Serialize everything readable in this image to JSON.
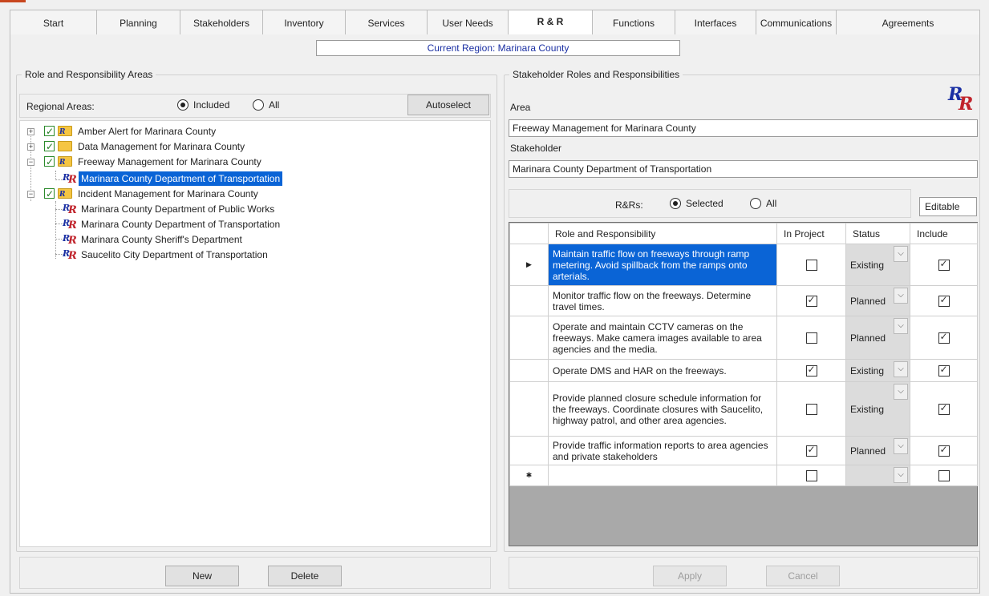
{
  "tabs": [
    {
      "label": "Start",
      "w": 0
    },
    {
      "label": "Planning"
    },
    {
      "label": "Stakeholders"
    },
    {
      "label": "Inventory"
    },
    {
      "label": "Services"
    },
    {
      "label": "User Needs"
    },
    {
      "label": "R & R",
      "active": true
    },
    {
      "label": "Functions"
    },
    {
      "label": "Interfaces"
    },
    {
      "label": "Communications"
    },
    {
      "label": "Agreements"
    }
  ],
  "region": "Current Region: Marinara County",
  "left": {
    "title": "Role and Responsibility Areas",
    "regional_label": "Regional Areas:",
    "radio_included": "Included",
    "radio_all": "All",
    "autoselect": "Autoselect",
    "tree": [
      {
        "label": "Amber Alert for Marinara County"
      },
      {
        "label": "Data Management for Marinara County"
      },
      {
        "label": "Freeway Management for Marinara County"
      },
      {
        "label": "Marinara County Department of Transportation"
      },
      {
        "label": "Incident Management for Marinara County"
      },
      {
        "label": "Marinara County Department of Public Works"
      },
      {
        "label": "Marinara County Department of Transportation"
      },
      {
        "label": "Marinara County Sheriff's Department"
      },
      {
        "label": "Saucelito City Department of Transportation"
      }
    ],
    "new_button": "New",
    "delete_button": "Delete"
  },
  "right": {
    "title": "Stakeholder Roles and Responsibilities",
    "area_label": "Area",
    "area_value": "Freeway Management for Marinara County",
    "stakeholder_label": "Stakeholder",
    "stakeholder_value": "Marinara County Department of Transportation",
    "rrs_label": "R&Rs:",
    "radio_selected": "Selected",
    "radio_all": "All",
    "editable": "Editable",
    "columns": [
      "Role and Responsibility",
      "In Project",
      "Status",
      "Include"
    ],
    "rows": [
      {
        "text": "Maintain traffic flow on freeways through ramp metering.  Avoid spillback from the ramps onto arterials.",
        "in_project": false,
        "status": "Existing",
        "include": true,
        "selected": true
      },
      {
        "text": "Monitor traffic flow on the freeways. Determine travel times.",
        "in_project": true,
        "status": "Planned",
        "include": true
      },
      {
        "text": "Operate and maintain CCTV cameras on the freeways.  Make camera images available to area agencies and the media.",
        "in_project": false,
        "status": "Planned",
        "include": true
      },
      {
        "text": "Operate DMS and HAR on the freeways.",
        "in_project": true,
        "status": "Existing",
        "include": true
      },
      {
        "text": "Provide planned closure schedule information for the freeways. Coordinate closures with Saucelito, highway patrol, and other area agencies.",
        "in_project": false,
        "status": "Existing",
        "include": true
      },
      {
        "text": "Provide traffic information reports to area agencies and private stakeholders",
        "in_project": true,
        "status": "Planned",
        "include": true
      }
    ],
    "apply_button": "Apply",
    "cancel_button": "Cancel"
  },
  "icons": {
    "rr_first": "R",
    "rr_second": "R",
    "row_pointer": "▶",
    "new_row": "✱",
    "combo_arrow": "⌵"
  }
}
